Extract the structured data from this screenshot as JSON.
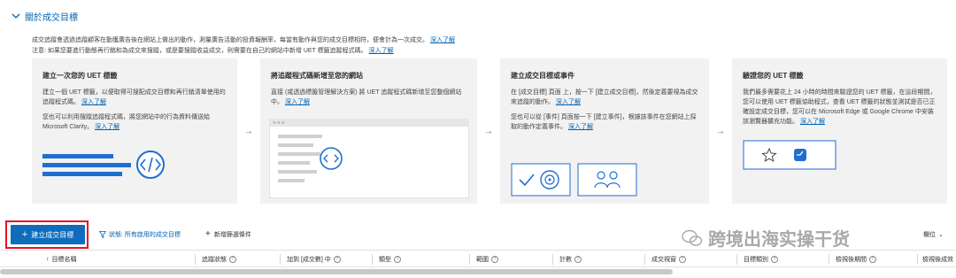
{
  "section": {
    "title": "關於成交目標"
  },
  "intro": {
    "line1": "成交追蹤會透過追蹤顧客在動獲廣告後在網站上做出的動作，測量廣告活動的投資報酬率，每當有動作與您的成交目標相符，便會計為一次成交。",
    "line1_link": "深入了解",
    "line2": "注意: 如果您要進行動態再行銷和為成交來搜蹤，或是要搜蹤收益成交，則需要在自己的網站中新增 UET 標籤追蹤程式碼。",
    "line2_link": "深入了解"
  },
  "cards": [
    {
      "title": "建立一次您的 UET 標籤",
      "p1": "建立一個 UET 標籤，以便取得可搜配成交目標和再行銷清單使用的追蹤程式碼。",
      "p1_link": "深入了解",
      "p2": "您也可以利用搜蹤追蹤程式碼，將您網站中的行為資料傳送給 Microsoft Clarity。",
      "p2_link": "深入了解"
    },
    {
      "title": "將追蹤程式碼新增至您的網站",
      "p1": "直接 (或透過標籤管理解決方案) 將 UET 追蹤程式碼新增至您整個網站中。",
      "p1_link": "深入了解"
    },
    {
      "title": "建立成交目標或事件",
      "p1": "在 [成交目標] 頁面 上，按一下 [建立成交目標]，然後定義要視為成交來追蹤的動作。",
      "p1_link": "深入了解",
      "p2": "您也可以從 [事件] 頁面按一下 [建立事件]，根據該事件在您網站上採取的動作定義事件。",
      "p2_link": "深入了解"
    },
    {
      "title": "驗證您的 UET 標籤",
      "p1": "我們最多需要花上 24 小時的時間來驗證您的 UET 標籤，在這段期間，您可以使用 UET 標籤協助程式，查看 UET 標籤的狀態並測試是否已正確設定成交目標，您可以在 Microsoft Edge 或 Google Chrome 中安裝該瀏覽器擴充功能。",
      "p1_link": "深入了解"
    }
  ],
  "toolbar": {
    "create_label": "建立成交目標",
    "filter_label": "狀態: 所有啟用的成交目標",
    "add_filter_label": "新增篩選條件",
    "watermark": "跨境出海实操干货",
    "columns_label": "欄位"
  },
  "grid": {
    "columns": [
      "目標名稱",
      "追蹤狀態",
      "加到 [成交數] 中",
      "類型",
      "範圍",
      "計數",
      "成交視窗",
      "目標類別",
      "檢視後期間",
      "檢視後成效"
    ]
  },
  "colors": {
    "accent": "#0f6cbd",
    "link": "#0063b1",
    "highlight": "#e81123",
    "card_bg": "#f2f2f2"
  }
}
